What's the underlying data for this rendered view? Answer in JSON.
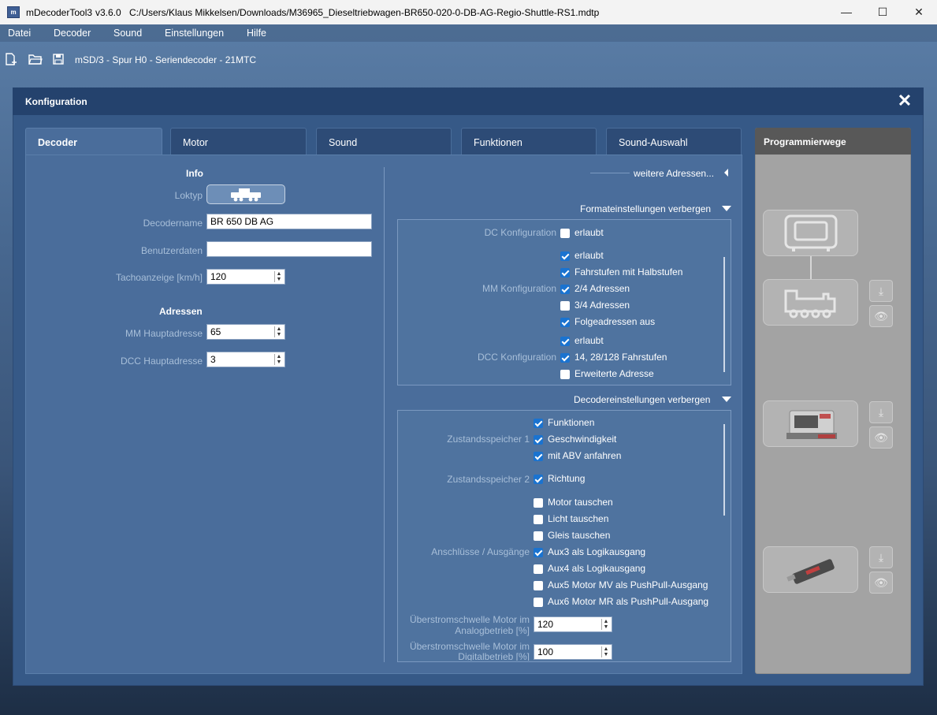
{
  "window": {
    "app_name": "mDecoderTool3",
    "version": "v3.6.0",
    "file_path": "C:/Users/Klaus Mikkelsen/Downloads/M36965_Dieseltriebwagen-BR650-020-0-DB-AG-Regio-Shuttle-RS1.mdtp",
    "minimize": "—",
    "maximize": "☐",
    "close": "✕"
  },
  "menu": [
    "Datei",
    "Decoder",
    "Sound",
    "Einstellungen",
    "Hilfe"
  ],
  "toolbar": {
    "decoder_info": "mSD/3 - Spur H0 - Seriendecoder - 21MTC"
  },
  "dialog": {
    "title": "Konfiguration",
    "tabs": [
      "Decoder",
      "Motor",
      "Sound",
      "Funktionen",
      "Sound-Auswahl"
    ],
    "right_panel_title": "Programmierwege"
  },
  "info": {
    "title": "Info",
    "loktyp_label": "Loktyp",
    "decodername_label": "Decodername",
    "decodername_value": "BR 650 DB AG",
    "benutzerdaten_label": "Benutzerdaten",
    "benutzerdaten_value": "",
    "tacho_label": "Tachoanzeige [km/h]",
    "tacho_value": "120"
  },
  "adressen": {
    "title": "Adressen",
    "mm_label": "MM Hauptadresse",
    "mm_value": "65",
    "dcc_label": "DCC Hauptadresse",
    "dcc_value": "3"
  },
  "right": {
    "weitere": "weitere Adressen...",
    "format_toggle": "Formateinstellungen verbergen",
    "dc_label": "DC Konfiguration",
    "mm_label": "MM Konfiguration",
    "dcc_label": "DCC Konfiguration",
    "dc_options": [
      {
        "label": "erlaubt",
        "checked": false
      }
    ],
    "mm_options": [
      {
        "label": "erlaubt",
        "checked": true
      },
      {
        "label": "Fahrstufen mit Halbstufen",
        "checked": true
      },
      {
        "label": "2/4 Adressen",
        "checked": true
      },
      {
        "label": "3/4 Adressen",
        "checked": false
      },
      {
        "label": "Folgeadressen aus",
        "checked": true
      }
    ],
    "dcc_options": [
      {
        "label": "erlaubt",
        "checked": true
      },
      {
        "label": "14, 28/128 Fahrstufen",
        "checked": true
      },
      {
        "label": "Erweiterte Adresse",
        "checked": false
      }
    ],
    "decoder_toggle": "Decodereinstellungen verbergen",
    "zs1_label": "Zustandsspeicher 1",
    "zs2_label": "Zustandsspeicher 2",
    "anschl_label": "Anschlüsse / Ausgänge",
    "zs1_options": [
      {
        "label": "Funktionen",
        "checked": true
      },
      {
        "label": "Geschwindigkeit",
        "checked": true
      },
      {
        "label": "mit ABV anfahren",
        "checked": true
      }
    ],
    "zs2_options": [
      {
        "label": "Richtung",
        "checked": true
      }
    ],
    "anschl_options": [
      {
        "label": "Motor tauschen",
        "checked": false
      },
      {
        "label": "Licht tauschen",
        "checked": false
      },
      {
        "label": "Gleis tauschen",
        "checked": false
      },
      {
        "label": "Aux3 als Logikausgang",
        "checked": true
      },
      {
        "label": "Aux4 als Logikausgang",
        "checked": false
      },
      {
        "label": "Aux5 Motor MV als PushPull-Ausgang",
        "checked": false
      },
      {
        "label": "Aux6 Motor MR als PushPull-Ausgang",
        "checked": false
      }
    ],
    "analog_label_1": "Überstromschwelle Motor im",
    "analog_label_2": "Analogbetrieb [%]",
    "analog_value": "120",
    "digital_label_1": "Überstromschwelle Motor im",
    "digital_label_2": "Digitalbetrieb [%]",
    "digital_value": "100"
  }
}
